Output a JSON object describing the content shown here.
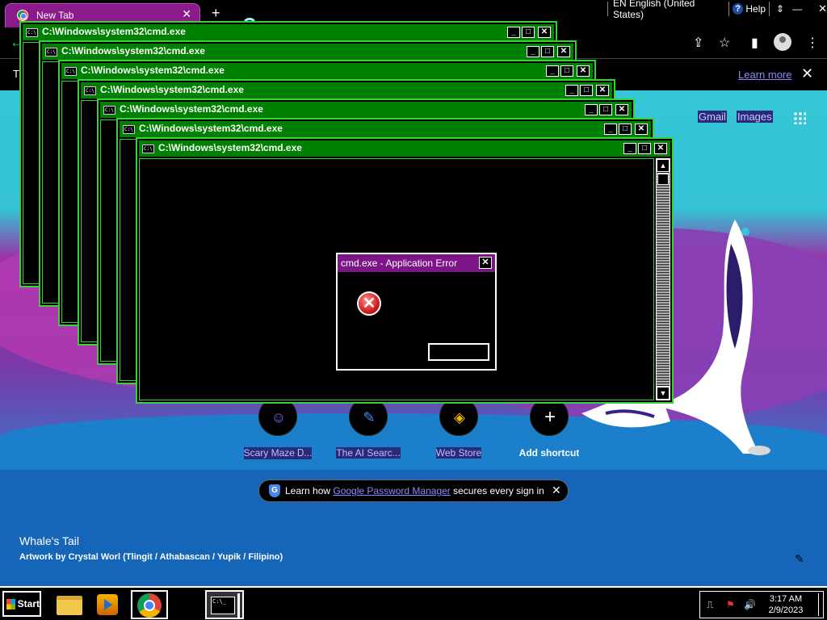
{
  "browser": {
    "tab_title": "New Tab",
    "tab_close": "✕",
    "new_tab": "+",
    "infobar_letter": "T",
    "learn_more": "Learn more",
    "infobar_close": "✕",
    "back": "←",
    "share": "⇪",
    "bookmark": "☆",
    "sidepanel": "▮",
    "menu": "⋮"
  },
  "language_bar": {
    "language": "EN English (United States)",
    "help_icon": "?",
    "help_label": "Help",
    "options": "⇕",
    "minimize": "—",
    "close": "✕"
  },
  "newtab": {
    "links": [
      "Gmail",
      "Images"
    ],
    "shortcuts": [
      {
        "label": "Scary Maze Ꭰ...",
        "glyph": "☺"
      },
      {
        "label": "The AI Searc...",
        "glyph": "✎"
      },
      {
        "label": "Web Store",
        "glyph": "◈"
      },
      {
        "label": "Add shortcut",
        "glyph": "+"
      }
    ],
    "password_banner": {
      "prefix": "Learn how ",
      "link": "Google Password Manager",
      "suffix": " secures every sign in",
      "close": "✕",
      "shield": "G"
    },
    "artwork_title": "Whale's Tail",
    "artwork_credit": "Artwork by Crystal Worl (Tlingit / Athabascan / Yupik / Filipino)",
    "customize": "✎"
  },
  "cmd_windows": {
    "title": "C:\\Windows\\system32\\cmd.exe",
    "icon_text": "C:\\",
    "min": "_",
    "max": "□",
    "close": "✕",
    "up": "▲",
    "down": "▼"
  },
  "error_dialog": {
    "title": "cmd.exe - Application Error",
    "close": "✕",
    "icon": "✕",
    "ok": ""
  },
  "taskbar": {
    "start": "Start",
    "cmd_icon_text": "C:\\_",
    "time": "3:17 AM",
    "date": "2/9/2023",
    "tray_icons": [
      "⎍",
      "⚑",
      "🔊"
    ]
  }
}
